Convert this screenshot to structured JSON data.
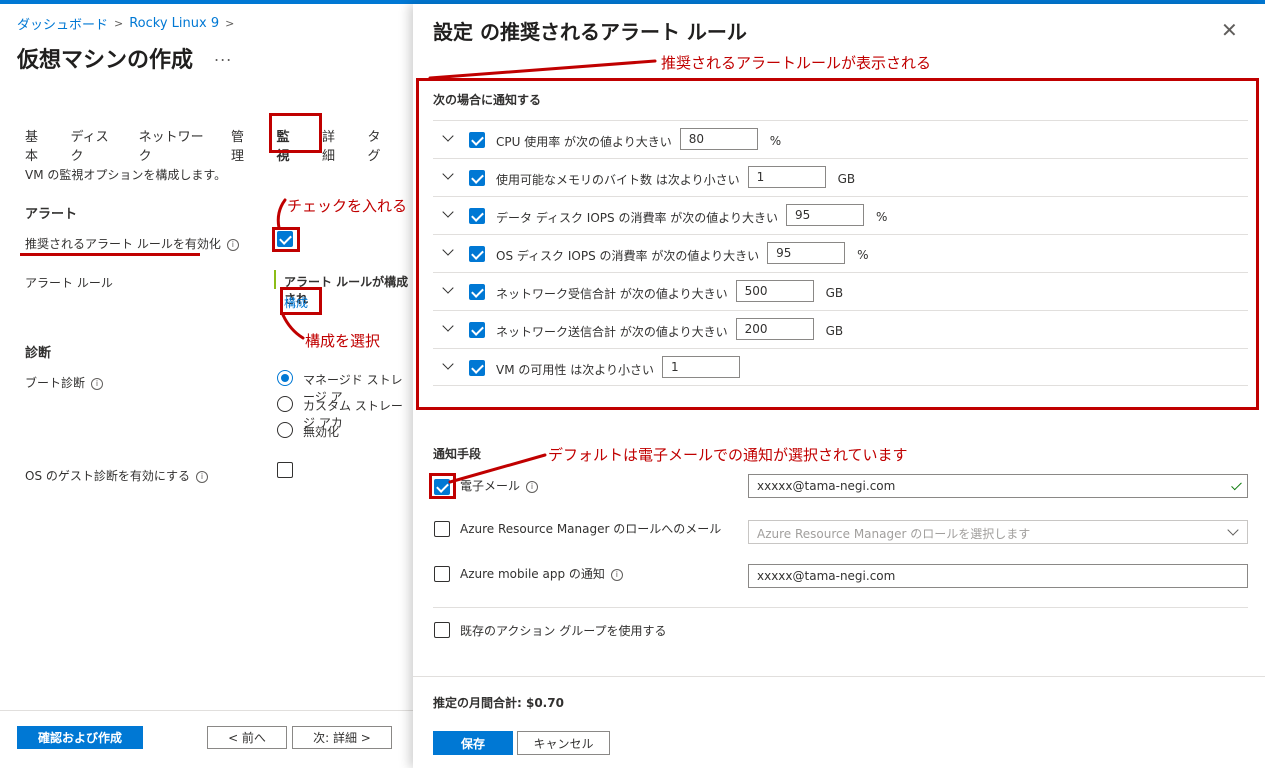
{
  "breadcrumb": {
    "home": "ダッシュボード",
    "item": "Rocky Linux 9"
  },
  "page": {
    "title": "仮想マシンの作成",
    "more": "..."
  },
  "tabs": [
    "基本",
    "ディスク",
    "ネットワーク",
    "管理",
    "監視",
    "詳細",
    "タグ"
  ],
  "active_tab": "監視",
  "left": {
    "description": "VM の監視オプションを構成します。",
    "alerts_header": "アラート",
    "enable_rules_label": "推奨されるアラート ルールを有効化",
    "enable_rules_checked": true,
    "alert_rules_label": "アラート ルール",
    "alert_rules_status": "アラート ルールが構成され",
    "configure_link": "構成",
    "diagnostics_header": "診断",
    "boot_diag_label": "ブート診断",
    "boot_options": [
      "マネージド ストレージ ア",
      "カスタム ストレージ アカ",
      "無効化"
    ],
    "boot_selected_index": 0,
    "guest_diag_label": "OS のゲスト診断を有効にする",
    "guest_diag_checked": false
  },
  "footer_left": {
    "review_create": "確認および作成",
    "prev": "< 前へ",
    "next": "次: 詳細 >"
  },
  "panel": {
    "title": "設定 の推奨されるアラート ルール",
    "close": "✕",
    "notify_when": "次の場合に通知する",
    "rules": [
      {
        "text": "CPU 使用率 が次の値より大きい",
        "value": "80",
        "unit": "%",
        "checked": true
      },
      {
        "text": "使用可能なメモリのバイト数 は次より小さい",
        "value": "1",
        "unit": "GB",
        "checked": true
      },
      {
        "text": "データ ディスク IOPS の消費率 が次の値より大きい",
        "value": "95",
        "unit": "%",
        "checked": true
      },
      {
        "text": "OS ディスク IOPS の消費率 が次の値より大きい",
        "value": "95",
        "unit": "%",
        "checked": true
      },
      {
        "text": "ネットワーク受信合計 が次の値より大きい",
        "value": "500",
        "unit": "GB",
        "checked": true
      },
      {
        "text": "ネットワーク送信合計 が次の値より大きい",
        "value": "200",
        "unit": "GB",
        "checked": true
      },
      {
        "text": "VM の可用性 は次より小さい",
        "value": "1",
        "unit": "",
        "checked": true
      }
    ],
    "notify_method": "通知手段",
    "email_label": "電子メール",
    "email_checked": true,
    "email_value": "xxxxx@tama-negi.com",
    "arm_label": "Azure Resource Manager のロールへのメール",
    "arm_checked": false,
    "arm_placeholder": "Azure Resource Manager のロールを選択します",
    "mobile_label": "Azure mobile app の通知",
    "mobile_checked": false,
    "mobile_value": "xxxxx@tama-negi.com",
    "action_group_label": "既存のアクション グループを使用する",
    "action_group_checked": false,
    "estimate": "推定の月間合計: $0.70",
    "save": "保存",
    "cancel": "キャンセル"
  },
  "annotations": {
    "check_it": "チェックを入れる",
    "select_configure": "構成を選択",
    "rules_shown": "推奨されるアラートルールが表示される",
    "default_email": "デフォルトは電子メールでの通知が選択されています"
  },
  "colors": {
    "accent": "#0078d4",
    "annotation": "#c00000"
  }
}
